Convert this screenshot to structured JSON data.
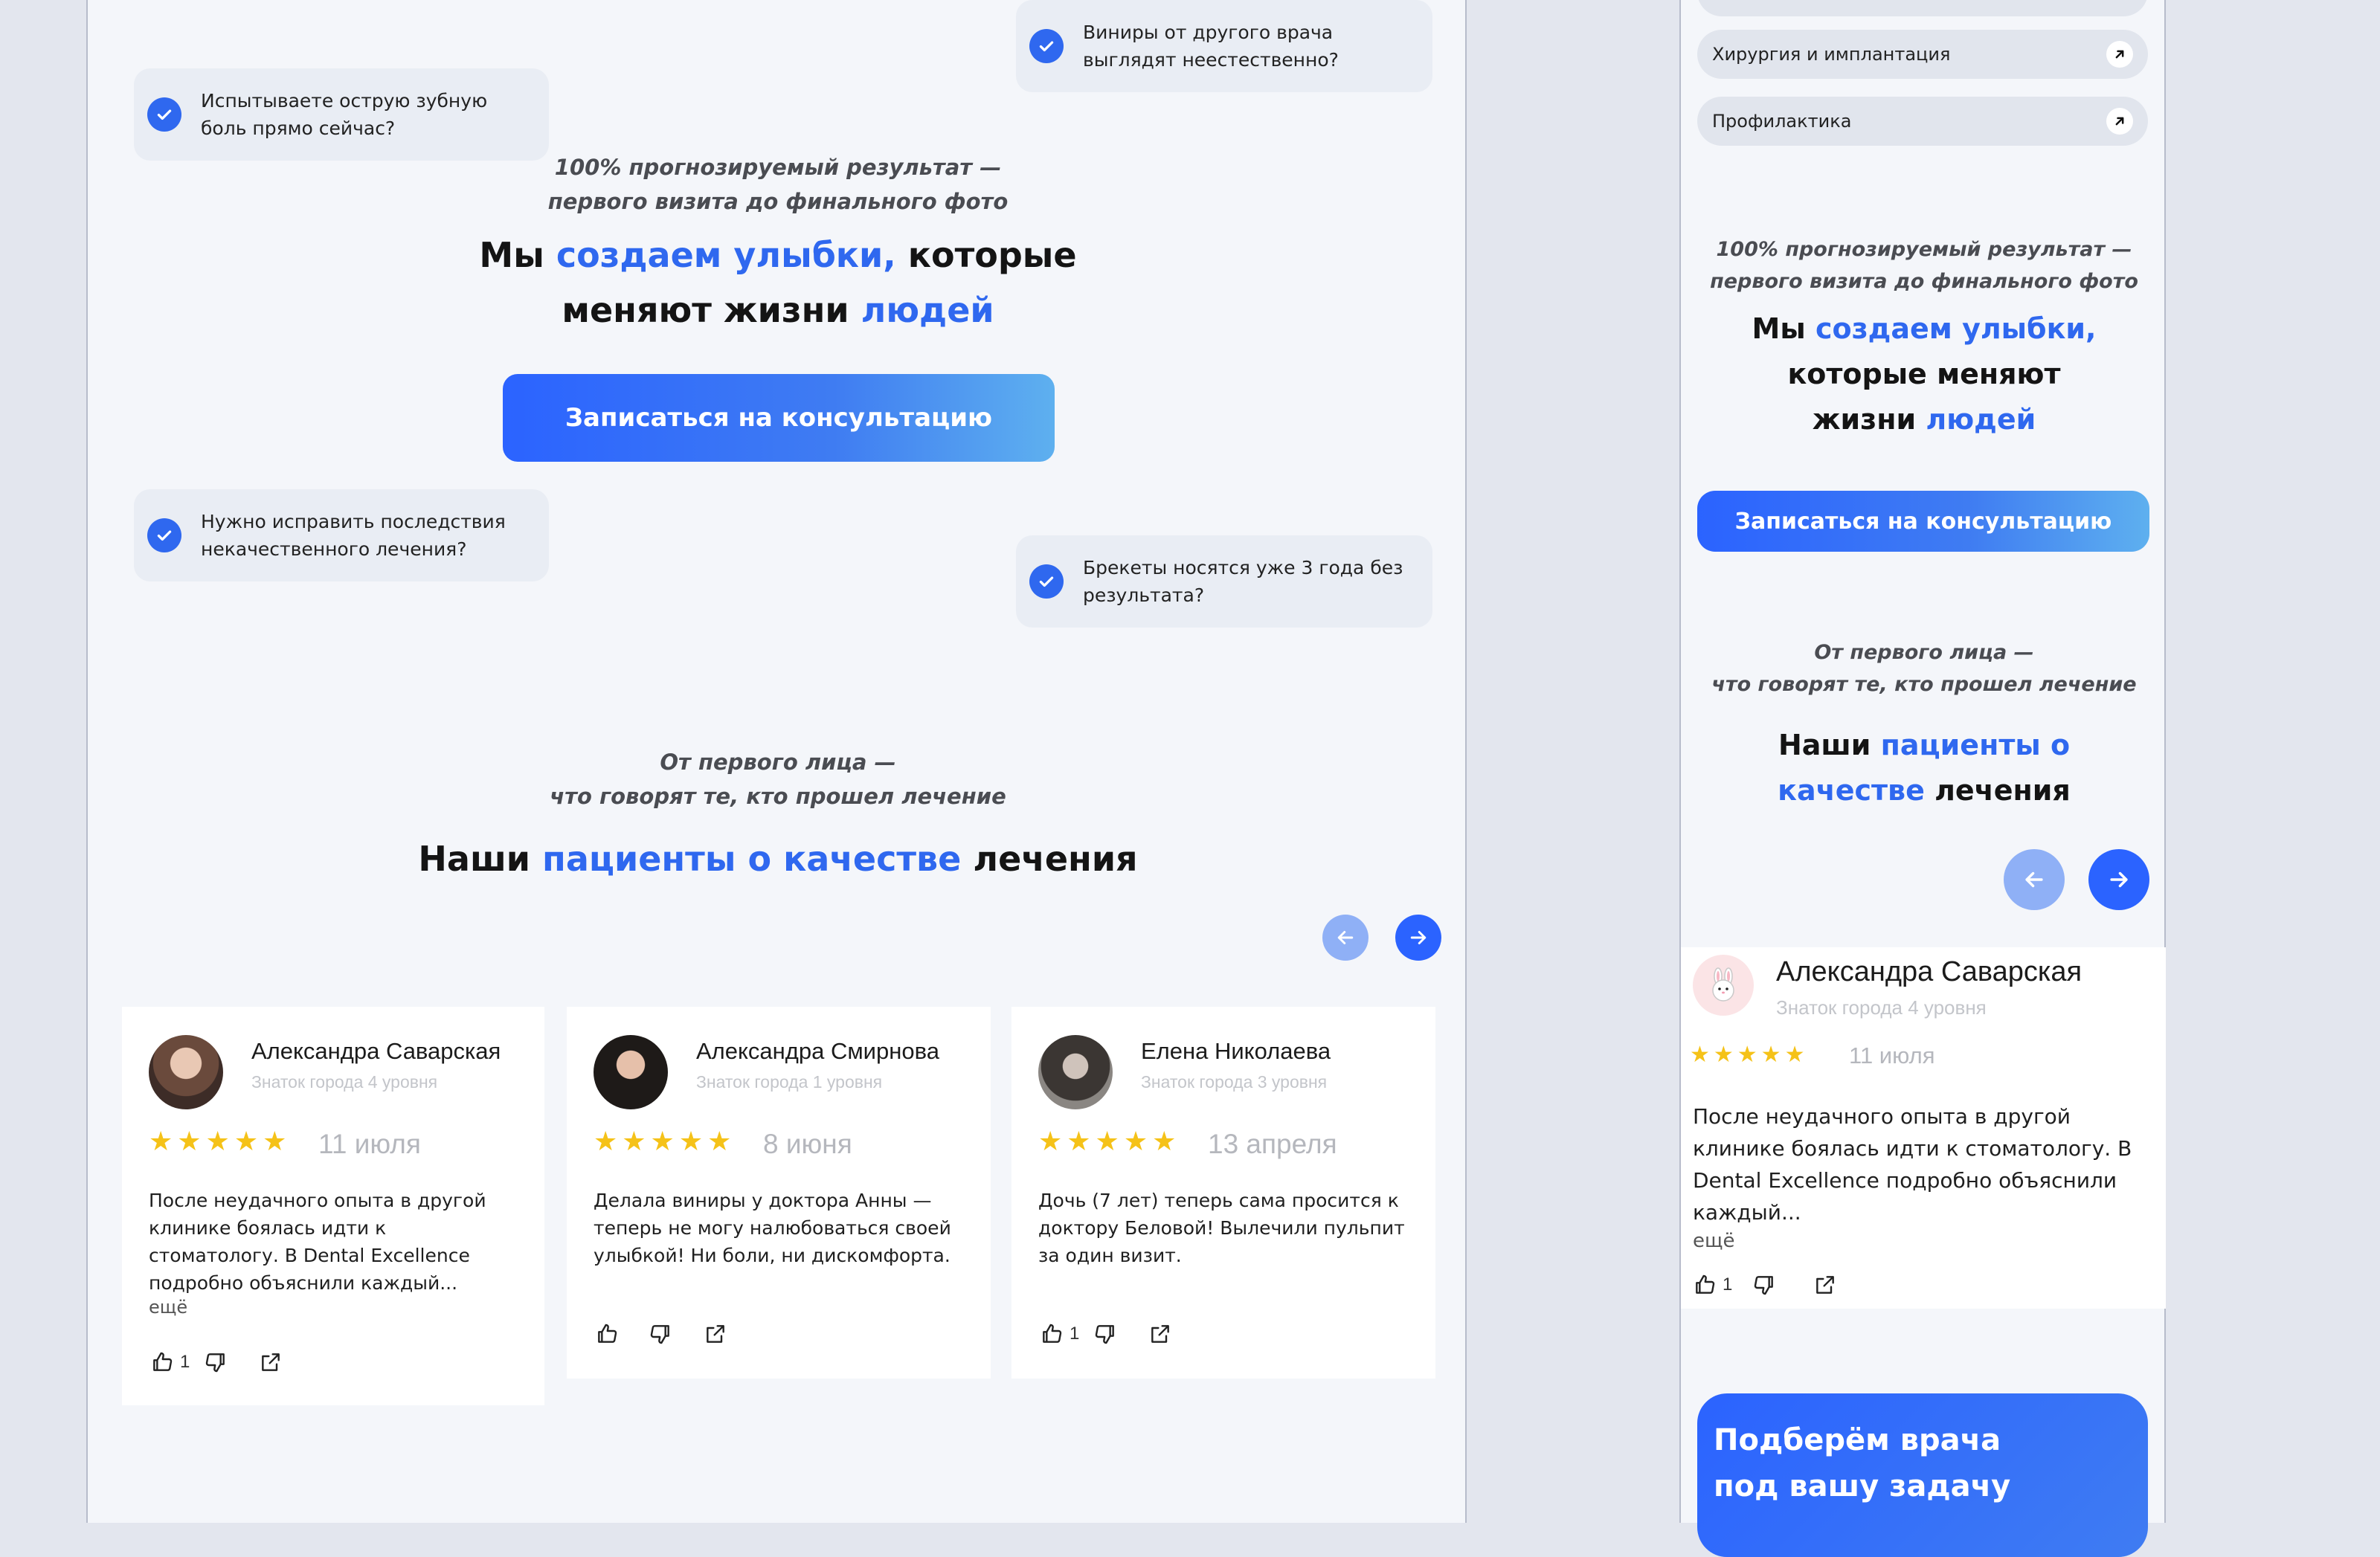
{
  "desktop": {
    "pills": [
      "Испытываете острую зубную боль прямо сейчас?",
      "Виниры от другого врача выглядят неестественно?",
      "Нужно исправить последствия некачественного лечения?",
      "Брекеты носятся уже 3 года без результата?"
    ],
    "hero": {
      "kicker_line1": "100% прогнозируемый результат —",
      "kicker_line2": "первого визита до финального фото",
      "h_part1": "Мы ",
      "h_hl1": "создаем улыбки,",
      "h_part2": " которые",
      "h_part3": "меняют жизни ",
      "h_hl2": "людей",
      "cta": "Записаться на консультацию"
    },
    "reviews_section": {
      "kicker_line1": "От первого лица —",
      "kicker_line2": "что говорят те, кто прошел лечение",
      "h_part1": "Наши ",
      "h_hl": "пациенты о качестве",
      "h_part2": " лечения"
    },
    "reviews": [
      {
        "name": "Александра Саварская",
        "level": "Знаток города 4 уровня",
        "stars": "★★★★★",
        "date": "11 июля",
        "text": "После неудачного опыта в другой клинике боялась идти к стоматологу. В Dental Excellence подробно объяснили каждый...",
        "more": "ещё",
        "likes": "1"
      },
      {
        "name": "Александра Смирнова",
        "level": "Знаток города 1 уровня",
        "stars": "★★★★★",
        "date": "8 июня",
        "text": "Делала виниры у доктора Анны — теперь не могу налюбоваться своей улыбкой! Ни боли, ни дискомфорта.",
        "more": "",
        "likes": ""
      },
      {
        "name": "Елена Николаева",
        "level": "Знаток города 3 уровня",
        "stars": "★★★★★",
        "date": "13 апреля",
        "text": "Дочь (7 лет) теперь сама просится к доктору Беловой! Вылечили пульпит за один визит.",
        "more": "",
        "likes": "1"
      }
    ]
  },
  "mobile": {
    "nav_items": [
      "Хирургия и имплантация",
      "Профилактика"
    ],
    "hero": {
      "kicker_line1": "100% прогнозируемый результат —",
      "kicker_line2": "первого визита до финального фото",
      "l1_part1": "Мы ",
      "l1_hl": "создаем улыбки,",
      "l2": "которые меняют",
      "l3_part1": "жизни ",
      "l3_hl": "людей",
      "cta": "Записаться на консультацию"
    },
    "reviews_section": {
      "kicker_line1": "От первого лица —",
      "kicker_line2": "что говорят те, кто прошел лечение",
      "l1_part1": "Наши ",
      "l1_hl": "пациенты о",
      "l2_hl": "качестве",
      "l2_part2": " лечения"
    },
    "review": {
      "name": "Александра Саварская",
      "level": "Знаток города 4 уровня",
      "stars": "★★★★★",
      "date": "11 июля",
      "text": "После неудачного опыта в другой клинике боялась идти к стоматологу. В Dental Excellence подробно объяснили каждый...",
      "more": "ещё",
      "likes": "1"
    },
    "doctor_card": {
      "line1": "Подберём врача",
      "line2": "под вашу задачу"
    }
  },
  "colors": {
    "accent": "#2f68ef",
    "star": "#f5c218",
    "page_bg": "#f4f6fa"
  }
}
